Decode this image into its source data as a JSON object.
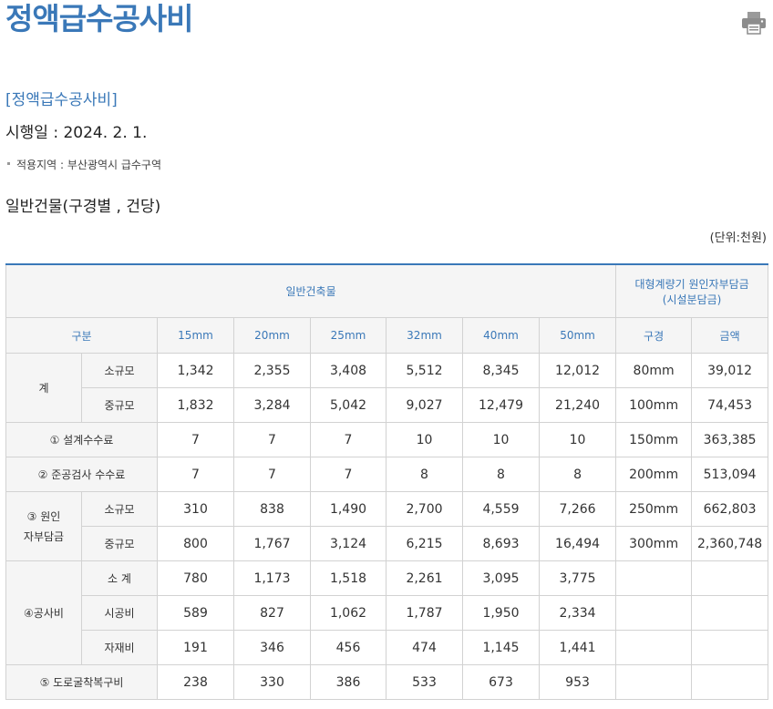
{
  "page": {
    "title": "정액급수공사비",
    "section_title": "[정액급수공사비]",
    "effective_date": "시행일 : 2024. 2. 1.",
    "region": "적용지역 : 부산광역시 급수구역",
    "sub_title": "일반건물(구경별 , 건당)",
    "unit": "(단위:천원)"
  },
  "icons": {
    "print": "print-icon"
  },
  "colors": {
    "accent": "#3a78b8",
    "header_bg": "#f5f5f5",
    "border": "#d2d2d2"
  },
  "table": {
    "group_general": "일반건축물",
    "group_meter": "대형계량기 원인자부담금",
    "group_meter_sub": "(시설분담금)",
    "col_category": "구분",
    "sizes": [
      "15mm",
      "20mm",
      "25mm",
      "32mm",
      "40mm",
      "50mm"
    ],
    "col_bore": "구경",
    "col_amount": "금액",
    "labels": {
      "total": "계",
      "small": "소규모",
      "medium": "중규모",
      "design_fee": "① 설계수수료",
      "inspection_fee": "② 준공검사 수수료",
      "burden_line1": "③ 원인",
      "burden_line2": "자부담금",
      "construction": "④공사비",
      "subtotal": "소 계",
      "labor": "시공비",
      "material": "자재비",
      "road": "⑤ 도로굴착복구비"
    },
    "rows": {
      "total_small": [
        "1,342",
        "2,355",
        "3,408",
        "5,512",
        "8,345",
        "12,012"
      ],
      "total_medium": [
        "1,832",
        "3,284",
        "5,042",
        "9,027",
        "12,479",
        "21,240"
      ],
      "design_fee": [
        "7",
        "7",
        "7",
        "10",
        "10",
        "10"
      ],
      "inspection_fee": [
        "7",
        "7",
        "7",
        "8",
        "8",
        "8"
      ],
      "burden_small": [
        "310",
        "838",
        "1,490",
        "2,700",
        "4,559",
        "7,266"
      ],
      "burden_medium": [
        "800",
        "1,767",
        "3,124",
        "6,215",
        "8,693",
        "16,494"
      ],
      "subtotal": [
        "780",
        "1,173",
        "1,518",
        "2,261",
        "3,095",
        "3,775"
      ],
      "labor": [
        "589",
        "827",
        "1,062",
        "1,787",
        "1,950",
        "2,334"
      ],
      "material": [
        "191",
        "346",
        "456",
        "474",
        "1,145",
        "1,441"
      ],
      "road": [
        "238",
        "330",
        "386",
        "533",
        "673",
        "953"
      ]
    },
    "meter": [
      {
        "bore": "80mm",
        "amount": "39,012"
      },
      {
        "bore": "100mm",
        "amount": "74,453"
      },
      {
        "bore": "150mm",
        "amount": "363,385"
      },
      {
        "bore": "200mm",
        "amount": "513,094"
      },
      {
        "bore": "250mm",
        "amount": "662,803"
      },
      {
        "bore": "300mm",
        "amount": "2,360,748"
      }
    ]
  }
}
